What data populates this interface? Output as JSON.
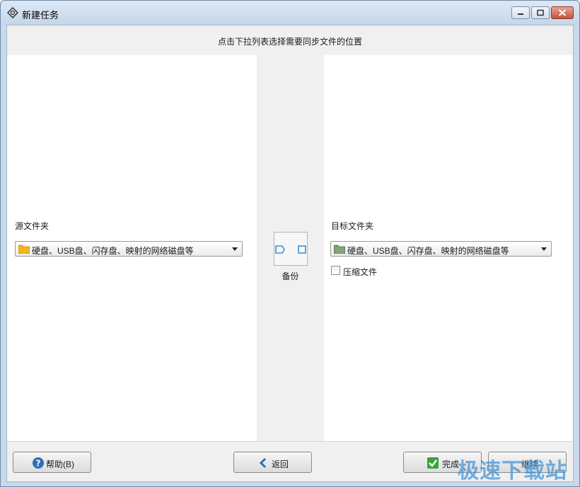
{
  "window": {
    "title": "新建任务",
    "icon": "sync-icon",
    "controls": [
      "minimize-icon",
      "maximize-icon",
      "close-icon"
    ]
  },
  "header": {
    "instruction": "点击下拉列表选择需要同步文件的位置"
  },
  "source": {
    "label": "源文件夹",
    "selected": "硬盘、USB盘、闪存盘、映射的网络磁盘等",
    "icon": "folder-icon",
    "icon_color": "#f2b619"
  },
  "mode": {
    "label": "备份",
    "icon": "backup-arrow-icon",
    "accent": "#3d8fd6"
  },
  "target": {
    "label": "目标文件夹",
    "selected": "硬盘、USB盘、闪存盘、映射的网络磁盘等",
    "icon": "folder-icon",
    "icon_color": "#7a9a6e",
    "compress_label": "压缩文件",
    "compress_checked": false
  },
  "footer": {
    "help_label": "帮助(B)",
    "back_label": "返回",
    "finish_label": "完成",
    "next_label": "继续"
  },
  "watermark": "极速下载站"
}
